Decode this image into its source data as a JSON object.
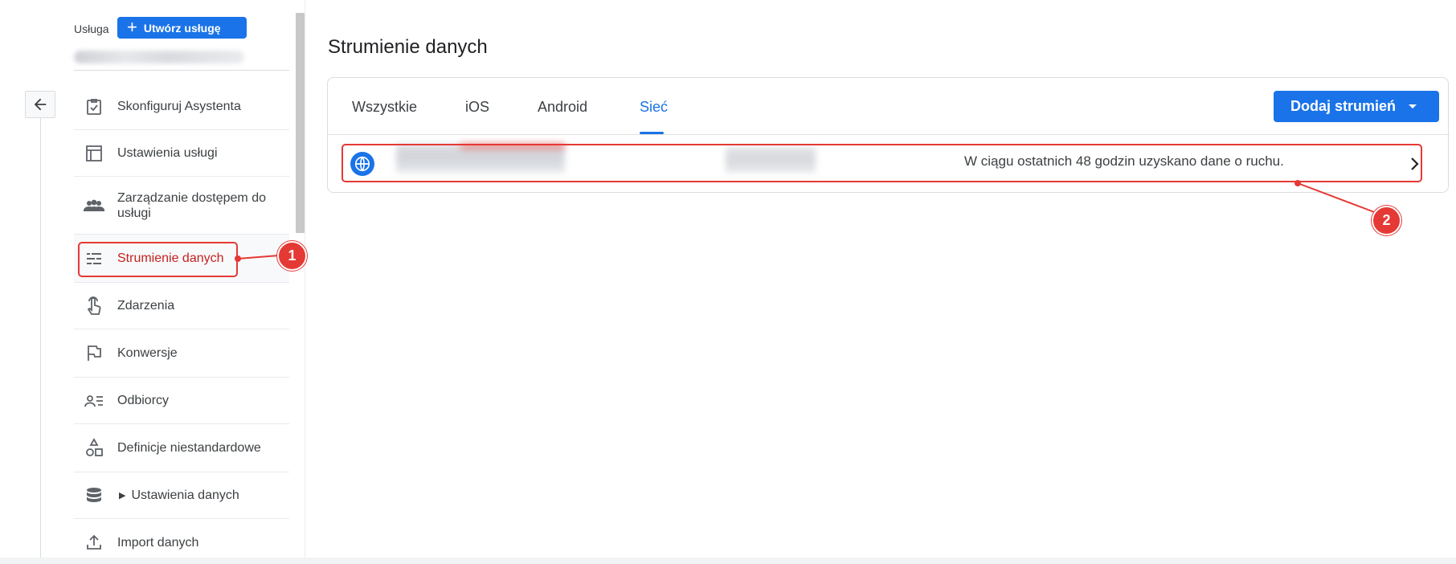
{
  "sidebar": {
    "usluga_label": "Usługa",
    "create_button_label": "Utwórz usługę",
    "items": [
      {
        "label": "Skonfiguruj Asystenta",
        "icon": "clipboard-check-icon"
      },
      {
        "label": "Ustawienia usługi",
        "icon": "layout-icon"
      },
      {
        "label": "Zarządzanie dostępem do usługi",
        "icon": "people-icon"
      },
      {
        "label": "Strumienie danych",
        "icon": "streams-icon",
        "active": true
      },
      {
        "label": "Zdarzenia",
        "icon": "touch-icon"
      },
      {
        "label": "Konwersje",
        "icon": "flag-icon"
      },
      {
        "label": "Odbiorcy",
        "icon": "audience-icon"
      },
      {
        "label": "Definicje niestandardowe",
        "icon": "shapes-icon"
      },
      {
        "label": "Ustawienia danych",
        "icon": "database-icon",
        "expandable": true
      },
      {
        "label": "Import danych",
        "icon": "upload-icon"
      }
    ]
  },
  "main": {
    "title": "Strumienie danych",
    "tabs": [
      {
        "label": "Wszystkie"
      },
      {
        "label": "iOS"
      },
      {
        "label": "Android"
      },
      {
        "label": "Sieć",
        "active": true
      }
    ],
    "add_stream_label": "Dodaj strumień",
    "stream": {
      "status": "W ciągu ostatnich 48 godzin uzyskano dane o ruchu."
    }
  },
  "annotations": {
    "badge1": "1",
    "badge2": "2"
  },
  "colors": {
    "accent": "#1a73e8",
    "active_text": "#c5221f",
    "annotation": "#e53935"
  }
}
